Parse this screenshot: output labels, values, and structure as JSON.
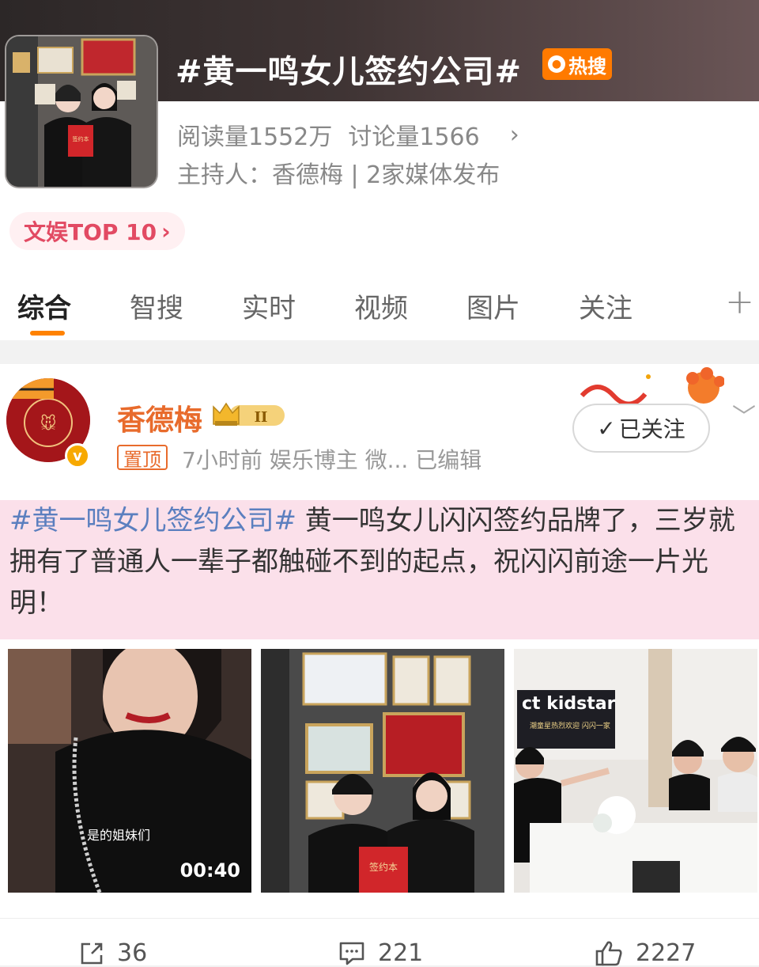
{
  "topic": {
    "title": "#黄一鸣女儿签约公司#",
    "badge_label": "热搜",
    "read_label": "阅读量1552万",
    "discuss_label": "讨论量1566",
    "host_line": "主持人：香德梅 | 2家媒体发布",
    "rank_chip": "文娱TOP 10"
  },
  "tabs": [
    "综合",
    "智搜",
    "实时",
    "视频",
    "图片",
    "关注"
  ],
  "post": {
    "author": "香德梅",
    "level_badge": "II",
    "pinned": "置顶",
    "meta": "7小时前  娱乐博主 微...  已编辑",
    "follow_label": "已关注",
    "hashtag": "#黄一鸣女儿签约公司#",
    "body": " 黄一鸣女儿闪闪签约品牌了，三岁就拥有了普通人一辈子都触碰不到的起点，祝闪闪前途一片光明！",
    "media": [
      {
        "caption": "是的姐妹们",
        "duration": "00:40"
      },
      {
        "caption": "签约本"
      },
      {
        "caption": "ct kidstar",
        "sub": "潮童星热烈欢迎 闪闪一家"
      }
    ],
    "actions": {
      "repost": "36",
      "comment": "221",
      "like": "2227"
    }
  },
  "colors": {
    "accent": "#ff8200",
    "hot": "#ff7a00",
    "author": "#e86b2c",
    "hashtag": "#5b7fbf",
    "highlight_bg": "#fbe0ea",
    "rank": "#e24a63"
  }
}
